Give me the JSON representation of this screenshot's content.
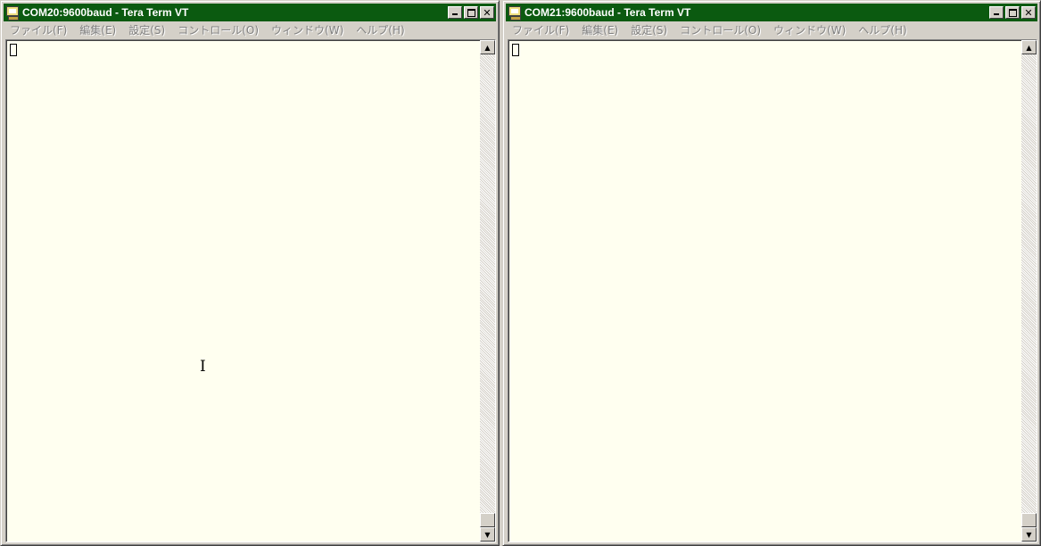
{
  "windows": [
    {
      "title": "COM20:9600baud - Tera Term VT",
      "menu": [
        "ファイル(F)",
        "編集(E)",
        "設定(S)",
        "コントロール(O)",
        "ウィンドウ(W)",
        "ヘルプ(H)"
      ],
      "titlebar_color": "#0b5a10",
      "terminal_bg": "#fffff0"
    },
    {
      "title": "COM21:9600baud - Tera Term VT",
      "menu": [
        "ファイル(F)",
        "編集(E)",
        "設定(S)",
        "コントロール(O)",
        "ウィンドウ(W)",
        "ヘルプ(H)"
      ],
      "titlebar_color": "#0b5a10",
      "terminal_bg": "#fffff0"
    }
  ],
  "titlebar_buttons": {
    "close": "✕"
  },
  "scrollbar": {
    "up": "▲",
    "down": "▼"
  },
  "ibeam_glyph": "I",
  "icons": {
    "app": "teraterm-icon",
    "minimize": "minimize-icon",
    "maximize": "maximize-icon",
    "close": "close-icon",
    "scroll_up": "scroll-up-arrow-icon",
    "scroll_down": "scroll-down-arrow-icon",
    "text_cursor": "ibeam-cursor-icon"
  }
}
